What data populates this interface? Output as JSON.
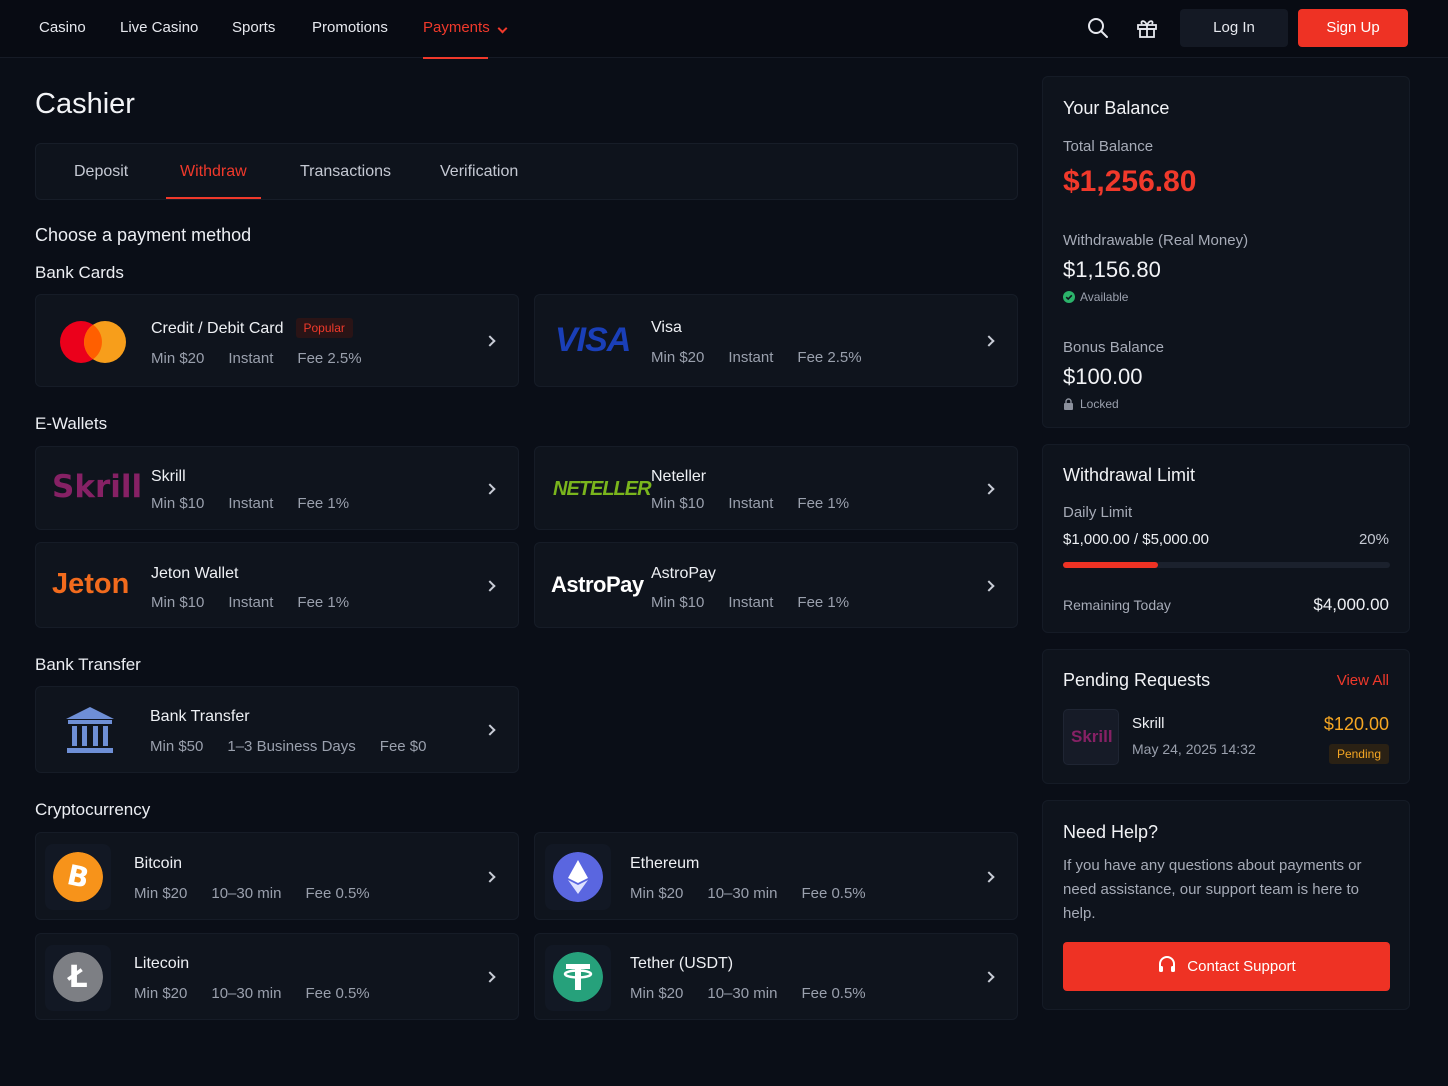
{
  "nav": {
    "items": [
      "Casino",
      "Live Casino",
      "Sports",
      "Promotions",
      "Payments"
    ],
    "login": "Log In",
    "signup": "Sign Up",
    "icons": [
      "search-icon",
      "gift-icon"
    ]
  },
  "page": {
    "title": "Cashier"
  },
  "tabs": [
    "Deposit",
    "Withdraw",
    "Transactions",
    "Verification"
  ],
  "main": {
    "subtitle": "Choose a payment method",
    "sections": {
      "bank_cards": "Bank Cards",
      "ewallets": "E-Wallets",
      "bank_transfer": "Bank Transfer",
      "crypto": "Cryptocurrency"
    }
  },
  "methods": {
    "card": {
      "name": "Credit / Debit Card",
      "badge": "Popular",
      "min": "Min $20",
      "speed": "Instant",
      "fee": "Fee 2.5%"
    },
    "visa": {
      "name": "Visa",
      "logo": "VISA",
      "min": "Min $20",
      "speed": "Instant",
      "fee": "Fee 2.5%"
    },
    "skrill": {
      "name": "Skrill",
      "logo": "Skrill",
      "min": "Min $10",
      "speed": "Instant",
      "fee": "Fee 1%"
    },
    "neteller": {
      "name": "Neteller",
      "logo": "NETELLER",
      "min": "Min $10",
      "speed": "Instant",
      "fee": "Fee 1%"
    },
    "jeton": {
      "name": "Jeton Wallet",
      "logo": "Jeton",
      "min": "Min $10",
      "speed": "Instant",
      "fee": "Fee 1%"
    },
    "astropay": {
      "name": "AstroPay",
      "logo": "AstroPay",
      "min": "Min $10",
      "speed": "Instant",
      "fee": "Fee 1%"
    },
    "bank": {
      "name": "Bank Transfer",
      "min": "Min $50",
      "speed": "1–3 Business Days",
      "fee": "Fee $0"
    },
    "bitcoin": {
      "name": "Bitcoin",
      "min": "Min $20",
      "speed": "10–30 min",
      "fee": "Fee 0.5%"
    },
    "ethereum": {
      "name": "Ethereum",
      "min": "Min $20",
      "speed": "10–30 min",
      "fee": "Fee 0.5%"
    },
    "litecoin": {
      "name": "Litecoin",
      "min": "Min $20",
      "speed": "10–30 min",
      "fee": "Fee 0.5%"
    },
    "tether": {
      "name": "Tether (USDT)",
      "min": "Min $20",
      "speed": "10–30 min",
      "fee": "Fee 0.5%"
    }
  },
  "balance": {
    "title": "Your Balance",
    "total_label": "Total Balance",
    "total": "$1,256.80",
    "withdrawable_label": "Withdrawable (Real Money)",
    "withdrawable": "$1,156.80",
    "available": "Available",
    "bonus_label": "Bonus Balance",
    "bonus": "$100.00",
    "locked": "Locked"
  },
  "limit": {
    "title": "Withdrawal Limit",
    "daily_label": "Daily Limit",
    "daily": "$1,000.00 / $5,000.00",
    "percent": "20%",
    "progress_fraction": 0.2,
    "remaining_label": "Remaining Today",
    "remaining": "$4,000.00"
  },
  "pending": {
    "title": "Pending Requests",
    "view_all": "View All",
    "item": {
      "logo": "Skrill",
      "name": "Skrill",
      "date": "May 24, 2025 14:32",
      "amount": "$120.00",
      "status": "Pending"
    }
  },
  "help": {
    "title": "Need Help?",
    "text": "If you have any questions about payments or need assistance, our support team is here to help.",
    "button": "Contact Support"
  },
  "colors": {
    "accent": "#ee3224",
    "background": "#0a0e17",
    "card": "#0f141d"
  }
}
